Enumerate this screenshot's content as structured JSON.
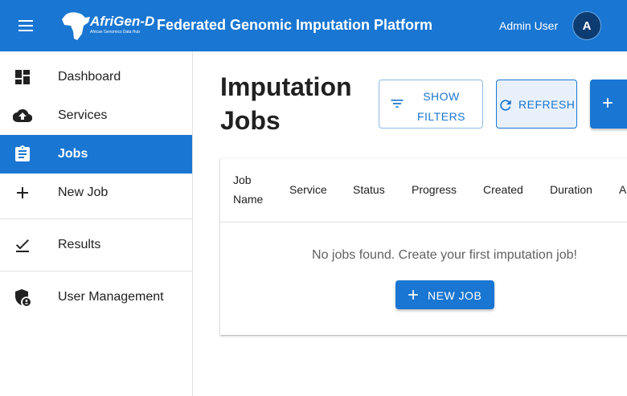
{
  "appbar": {
    "logo_text": "AfriGen-D",
    "logo_subtext": "African Genomics Data Hub",
    "title": "Federated Genomic Imputation Platform",
    "user_name": "Admin User",
    "avatar_initial": "A",
    "color": "#1976d2"
  },
  "sidebar": {
    "items": [
      {
        "label": "Dashboard",
        "icon": "dashboard-icon"
      },
      {
        "label": "Services",
        "icon": "cloud-upload-icon"
      },
      {
        "label": "Jobs",
        "icon": "clipboard-icon",
        "active": true
      },
      {
        "label": "New Job",
        "icon": "plus-icon"
      },
      {
        "label": "Results",
        "icon": "check-icon"
      },
      {
        "label": "User Management",
        "icon": "admin-shield-icon"
      }
    ]
  },
  "main": {
    "title": "Imputation Jobs",
    "buttons": {
      "show_filters": "SHOW FILTERS",
      "refresh": "REFRESH"
    },
    "table": {
      "columns": [
        "Job Name",
        "Service",
        "Status",
        "Progress",
        "Created",
        "Duration",
        "A"
      ],
      "empty_message": "No jobs found. Create your first imputation job!",
      "new_job_label": "NEW JOB"
    }
  }
}
